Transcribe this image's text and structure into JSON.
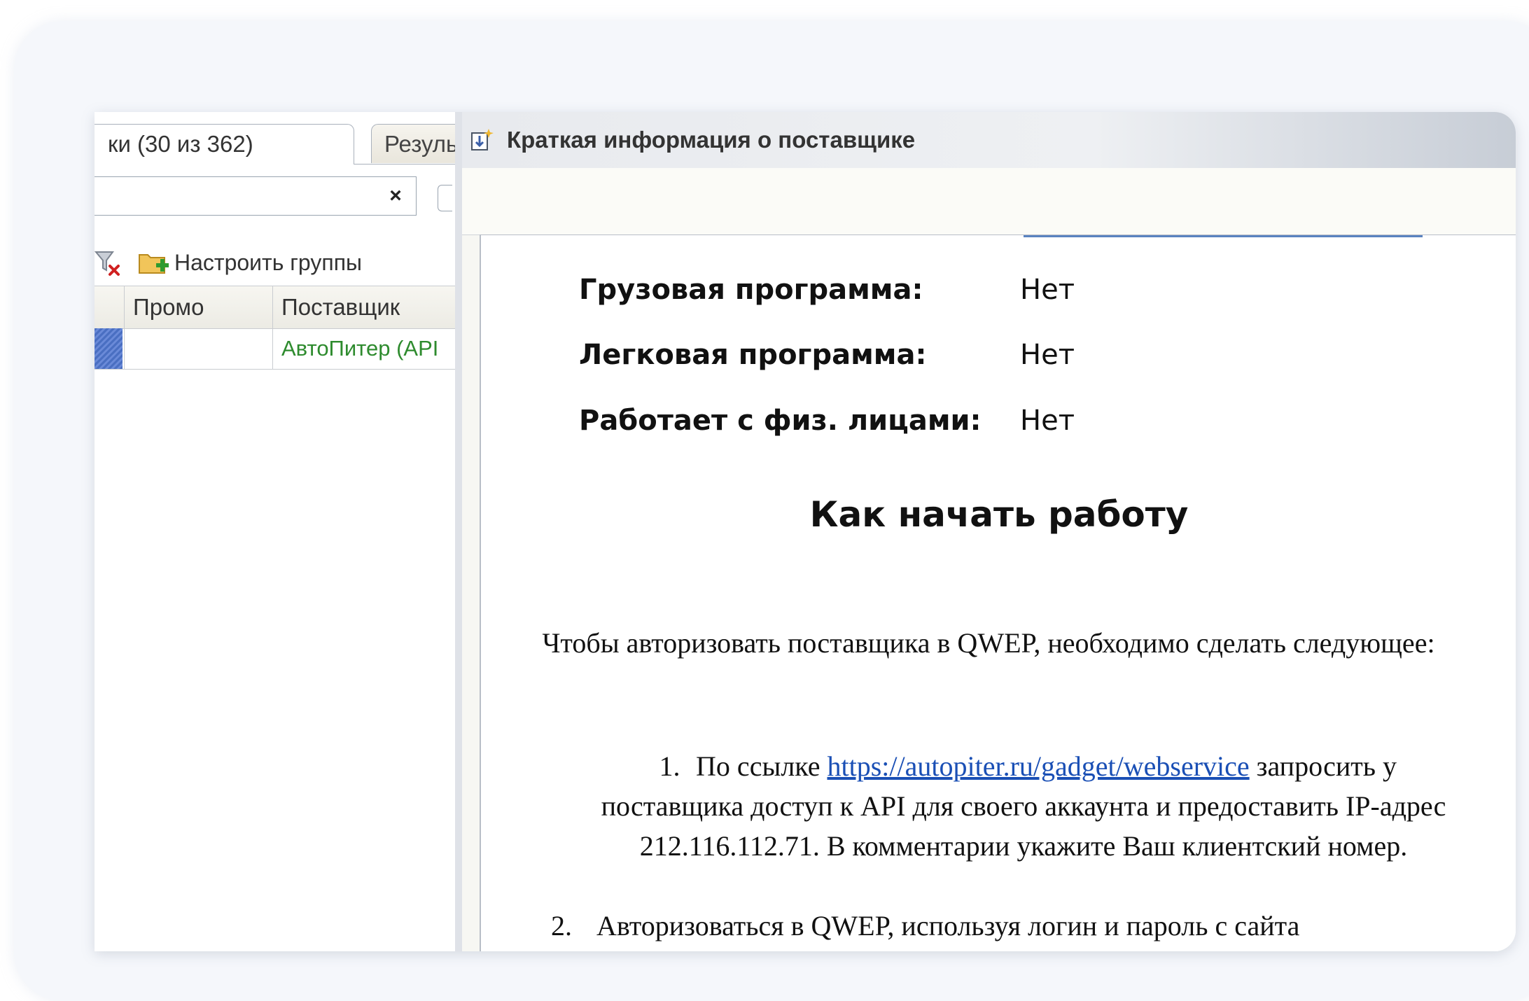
{
  "left_panel": {
    "tabs": [
      {
        "label": "ки (30 из 362)",
        "active": true
      },
      {
        "label": "Результаты",
        "active": false
      }
    ],
    "search": {
      "value": "",
      "clear_symbol": "×"
    },
    "toolbar": {
      "groups_label": "Настроить группы"
    },
    "table": {
      "headers": [
        "Промо",
        "Поставщик"
      ],
      "rows": [
        {
          "promo": "",
          "supplier": "АвтоПитер (API"
        }
      ]
    }
  },
  "dialog": {
    "title": "Краткая информация о поставщике",
    "info": [
      {
        "label": "Грузовая программа:",
        "value": "Нет"
      },
      {
        "label": "Легковая программа:",
        "value": "Нет"
      },
      {
        "label": "Работает с физ. лицами:",
        "value": "Нет"
      }
    ],
    "howto_title": "Как начать работу",
    "intro": "Чтобы авторизовать поставщика в QWEP, необходимо сделать следующее:",
    "step1": {
      "number": "1.",
      "before": "По ссылке",
      "link": "https://autopiter.ru/gadget/webservice",
      "after": "запросить у поставщика доступ к API для своего аккаунта и предоставить IP-адрес 212.116.112.71. В комментарии укажите Ваш клиентский номер."
    },
    "step2": {
      "number": "2.",
      "text": "Авторизоваться в QWEP, используя логин и пароль с сайта"
    }
  },
  "colors": {
    "link": "#1a4fb5",
    "supplier_text": "#2e8b2e",
    "row_marker": "#4a6fc2"
  }
}
